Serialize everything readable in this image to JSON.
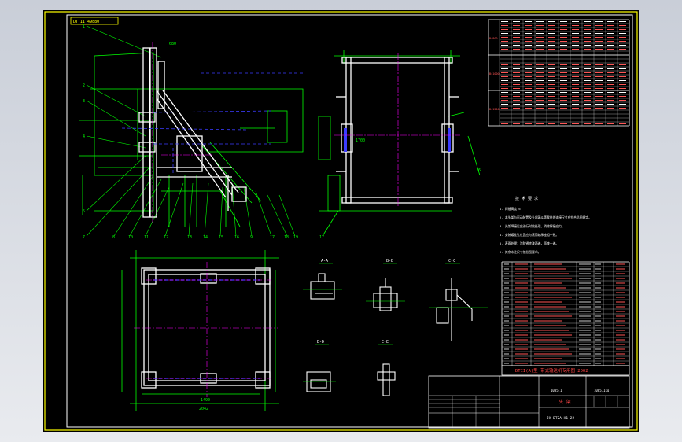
{
  "drawing": {
    "header_tag": "DT II 49880",
    "title_main": "DTII(A)型 带式输送机专用图 2002",
    "title_name": "头 架",
    "drawing_no": "JX-DT2A-H1-22",
    "weight_label": "1085.1",
    "weight_kg": "1085.1kg",
    "tech_title": "技 术 要 求",
    "tech_notes": [
      "1. 焊缝高度 6",
      "2. 本头架与驱动装置及头部漏斗等零件的连接尺寸应符合总图规定。",
      "3. 头架焊接后应进行时效处理，消除焊接应力。",
      "4. 安装螺栓孔位置应与滚筒轴承座相一致。",
      "5. 表面处理：涂防锈底漆两遍，面漆一遍。",
      "6. 其余未注尺寸按总图要求。"
    ],
    "section_labels": [
      "A-A",
      "B-B",
      "C-C",
      "D-D",
      "E-E"
    ],
    "section_scales": [
      "1:5",
      "1:5",
      "1:5",
      "1:5",
      "1:5"
    ],
    "dim_top_left": "680",
    "dim_plan_width": "1490",
    "dim_plan_inner": "2042",
    "dim_front": "1700",
    "table_groups": [
      "B=800",
      "B=1000",
      "B=1200"
    ],
    "accent": "#ffff00",
    "line_color": "#00ff00",
    "center_color": "#ff00ff",
    "hidden_color": "#3b3bff",
    "part_color": "#ffffff"
  }
}
